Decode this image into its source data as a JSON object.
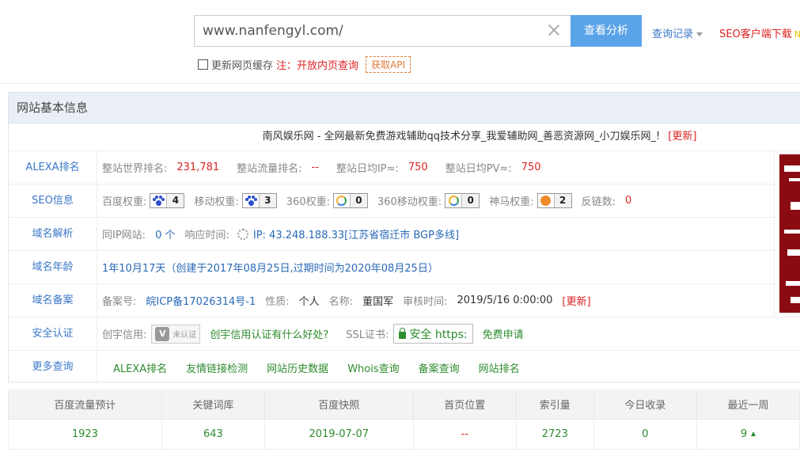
{
  "search": {
    "url": "www.nanfengyl.com/",
    "analyze_label": "查看分析",
    "history_label": "查询记录",
    "seo_client_label": "SEO客户端下载",
    "seo_client_tag": "N"
  },
  "options": {
    "cache_label": "更新网页缓存",
    "note": "注：开放内页查询",
    "api_label": "获取API"
  },
  "panel": {
    "heading": "网站基本信息",
    "site_title": "南风娱乐网 - 全网最新免费游戏辅助qq技术分享_我爱辅助网_善恶资源网_小刀娱乐网_!",
    "update_label": "[更新]"
  },
  "alexa": {
    "label": "ALEXA排名",
    "world_rank_key": "整站世界排名:",
    "world_rank": "231,781",
    "traffic_rank_key": "整站流量排名:",
    "traffic_rank": "--",
    "daily_ip_key": "整站日均IP≈:",
    "daily_ip": "750",
    "daily_pv_key": "整站日均PV≈:",
    "daily_pv": "750"
  },
  "seo": {
    "label": "SEO信息",
    "baidu_key": "百度权重:",
    "baidu": "4",
    "mobile_key": "移动权重:",
    "mobile": "3",
    "w360_key": "360权重:",
    "w360": "0",
    "w360m_key": "360移动权重:",
    "w360m": "0",
    "shenma_key": "神马权重:",
    "shenma": "2",
    "backlinks_key": "反链数:",
    "backlinks": "0"
  },
  "dns": {
    "label": "域名解析",
    "same_ip_key": "同IP网站:",
    "same_ip": "0 个",
    "response_key": "响应时间:",
    "ip": "IP: 43.248.188.33[江苏省宿迁市 BGP多线]"
  },
  "age": {
    "label": "域名年龄",
    "value": "1年10月17天（创建于2017年08月25日,过期时间为2020年08月25日）"
  },
  "icp": {
    "label": "域名备案",
    "no_key": "备案号:",
    "no": "皖ICP备17026314号-1",
    "type_key": "性质:",
    "type": "个人",
    "name_key": "名称:",
    "name": "董国军",
    "time_key": "审核时间:",
    "time": "2019/5/16 0:00:00",
    "update_label": "[更新]"
  },
  "security": {
    "label": "安全认证",
    "credit_key": "创宇信用:",
    "cert_text": "未认证",
    "cert_link": "创宇信用认证有什么好处?",
    "ssl_key": "SSL证书:",
    "ssl_badge": "安全 https:",
    "ssl_apply": "免费申请"
  },
  "more": {
    "label": "更多查询",
    "links": [
      "ALEXA排名",
      "友情链接检测",
      "网站历史数据",
      "Whois查询",
      "备案查询",
      "网站排名"
    ]
  },
  "stats": {
    "headers": [
      "百度流量预计",
      "关键词库",
      "百度快照",
      "首页位置",
      "索引量",
      "今日收录",
      "最近一周"
    ],
    "values": [
      "1923",
      "643",
      "2019-07-07",
      "--",
      "2723",
      "0",
      "9"
    ]
  },
  "colors": {
    "accent": "#5aa3e8",
    "link_blue": "#3a77c8",
    "red": "#dd2222",
    "green": "#2e8b2e"
  }
}
